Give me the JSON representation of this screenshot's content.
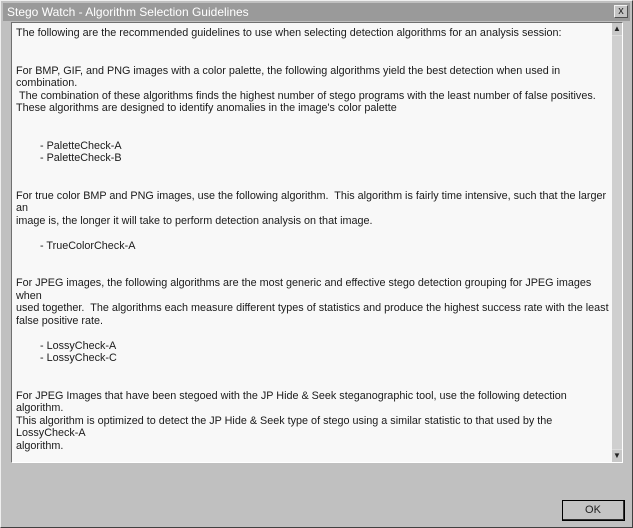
{
  "window": {
    "title": "Stego Watch - Algorithm Selection Guidelines",
    "close_glyph": "x"
  },
  "content": {
    "text": "The following are the recommended guidelines to use when selecting detection algorithms for an analysis session:\n\n\nFor BMP, GIF, and PNG images with a color palette, the following algorithms yield the best detection when used in combination.\n The combination of these algorithms finds the highest number of stego programs with the least number of false positives.\nThese algorithms are designed to identify anomalies in the image's color palette\n\n\n        - PaletteCheck-A\n        - PaletteCheck-B\n\n\nFor true color BMP and PNG images, use the following algorithm.  This algorithm is fairly time intensive, such that the larger an\nimage is, the longer it will take to perform detection analysis on that image.\n\n        - TrueColorCheck-A\n\n\nFor JPEG images, the following algorithms are the most generic and effective stego detection grouping for JPEG images when\nused together.  The algorithms each measure different types of statistics and produce the highest success rate with the least\nfalse positive rate.\n\n        - LossyCheck-A\n        - LossyCheck-C\n\n\nFor JPEG Images that have been stegoed with the JP Hide & Seek steganographic tool, use the following detection algorithm.\nThis algorithm is optimized to detect the JP Hide & Seek type of stego using a similar statistic to that used by the LossyCheck-A\nalgorithm.\n\n        - LossyCheck-B\n\nFor WAV files\n\n                - WAVCheck-A"
  },
  "scrollbar": {
    "up_glyph": "▲",
    "down_glyph": "▼"
  },
  "buttons": {
    "ok_label": "OK"
  }
}
